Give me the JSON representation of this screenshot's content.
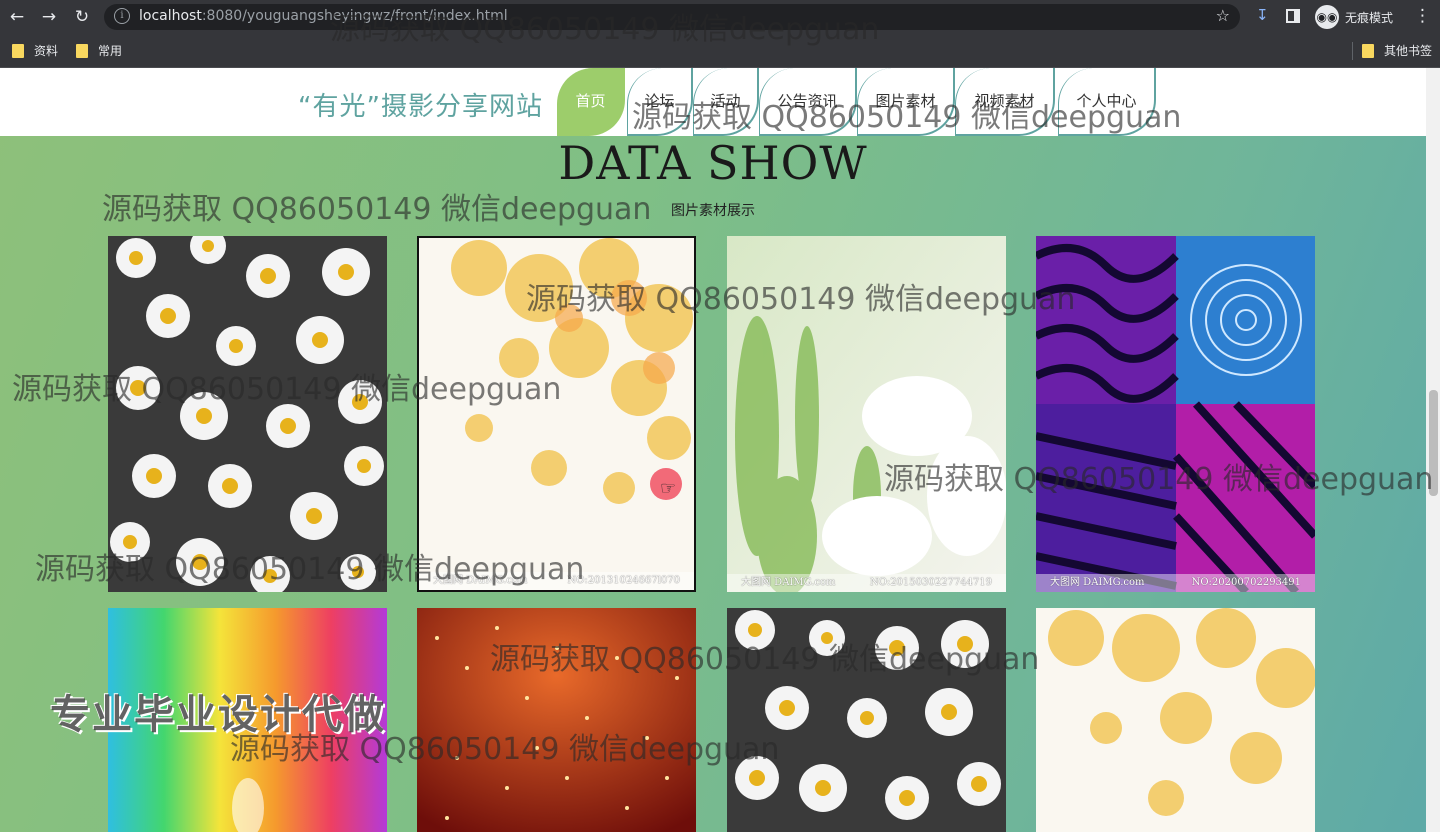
{
  "browser": {
    "url_host": "localhost",
    "url_rest": ":8080/youguangsheyingwz/front/index.html",
    "incognito_label": "无痕模式",
    "bookmarks": [
      "资料",
      "常用"
    ],
    "other_bookmarks": "其他书签"
  },
  "site": {
    "title": "“有光”摄影分享网站",
    "nav": [
      "首页",
      "论坛",
      "活动",
      "公告资讯",
      "图片素材",
      "视频素材",
      "个人中心"
    ],
    "active_nav": "首页"
  },
  "section": {
    "title": "DATA SHOW",
    "subtitle": "图片素材展示"
  },
  "cards": [
    {
      "kind": "daisies",
      "footer_left": "",
      "footer_right": ""
    },
    {
      "kind": "yellow-flowers",
      "footer_left": "大图网 DAIMG.com",
      "footer_right": "NO:20131024667l070"
    },
    {
      "kind": "white-lily",
      "footer_left": "大图网 DAIMG.com",
      "footer_right": "NO:2015030227744719"
    },
    {
      "kind": "psychedelic",
      "footer_left": "大图网 DAIMG.com",
      "footer_right": "NO:20200702293491"
    },
    {
      "kind": "rainbow-drop",
      "footer_left": "",
      "footer_right": ""
    },
    {
      "kind": "red-lights",
      "footer_left": "",
      "footer_right": ""
    },
    {
      "kind": "daisies",
      "footer_left": "",
      "footer_right": ""
    },
    {
      "kind": "yellow-flowers",
      "footer_left": "",
      "footer_right": ""
    }
  ],
  "watermarks": [
    "源码获取 QQ86050149 微信deepguan",
    "源码获取 QQ86050149 微信deepguan",
    "源码获取 QQ86050149 微信deepguan",
    "源码获取 QQ86050149 微信deepguan",
    "源码获取 QQ86050149 微信deepguan",
    "源码获取 QQ86050149 微信deepguan",
    "源码获取 QQ86050149 微信deepguan",
    "源码获取 QQ86050149 微信deepguan",
    "源码获取 QQ86050149 微信deepguan"
  ],
  "promo_text": "专业毕业设计代做"
}
